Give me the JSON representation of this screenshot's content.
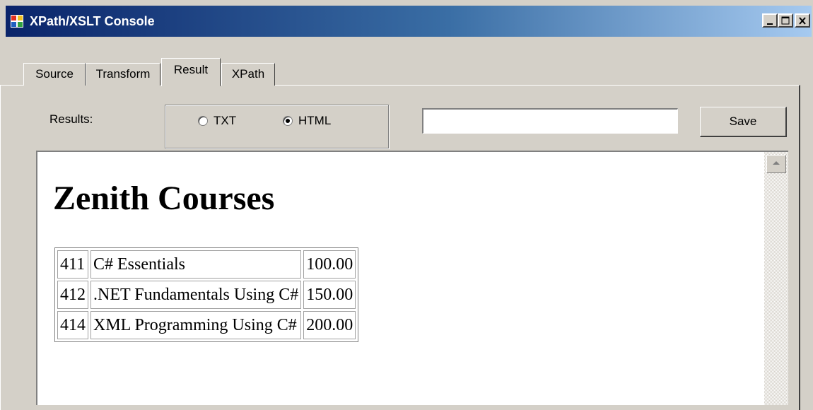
{
  "window": {
    "title": "XPath/XSLT Console",
    "controls": [
      "minimize-icon",
      "maximize-icon",
      "close-icon"
    ]
  },
  "tabs": [
    {
      "label": "Source",
      "selected": false
    },
    {
      "label": "Transform",
      "selected": false
    },
    {
      "label": "Result",
      "selected": true
    },
    {
      "label": "XPath",
      "selected": false
    }
  ],
  "result_panel": {
    "results_label": "Results:",
    "format_options": [
      {
        "label": "TXT",
        "checked": false
      },
      {
        "label": "HTML",
        "checked": true
      }
    ],
    "path_value": "",
    "save_label": "Save"
  },
  "document": {
    "heading": "Zenith Courses",
    "rows": [
      [
        "411",
        "C# Essentials",
        "100.00"
      ],
      [
        "412",
        ".NET Fundamentals Using C#",
        "150.00"
      ],
      [
        "414",
        "XML Programming Using C#",
        "200.00"
      ]
    ]
  },
  "colors": {
    "title_bar_start": "#0a246a",
    "title_bar_end": "#a6caf0",
    "window_face": "#d4d0c8"
  }
}
